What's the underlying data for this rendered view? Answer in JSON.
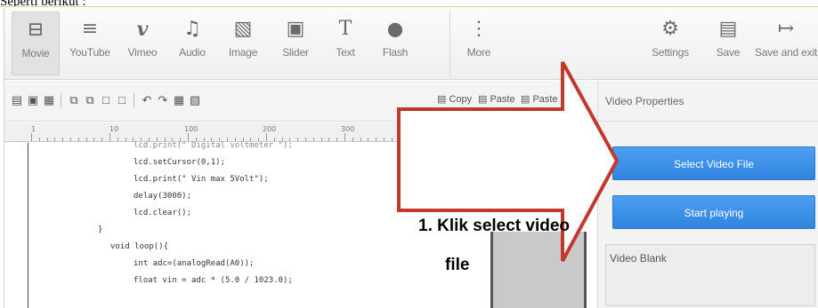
{
  "caption": "Seperti berikut :",
  "toolbar": {
    "items": [
      {
        "label": "Movie",
        "icon": "movie-icon",
        "glyph": "⊟"
      },
      {
        "label": "YouTube",
        "icon": "youtube-icon",
        "glyph": "≡"
      },
      {
        "label": "Vimeo",
        "icon": "vimeo-icon",
        "glyph": "v"
      },
      {
        "label": "Audio",
        "icon": "music-note-icon",
        "glyph": "♫"
      },
      {
        "label": "Image",
        "icon": "image-icon",
        "glyph": "▧"
      },
      {
        "label": "Slider",
        "icon": "slider-icon",
        "glyph": "▣"
      },
      {
        "label": "Text",
        "icon": "text-icon",
        "glyph": "T"
      },
      {
        "label": "Flash",
        "icon": "flash-icon",
        "glyph": "⬤"
      },
      {
        "label": "More",
        "icon": "more-icon",
        "glyph": "⋮"
      },
      {
        "label": "Settings",
        "icon": "gear-icon",
        "glyph": "⚙"
      },
      {
        "label": "Save",
        "icon": "save-icon",
        "glyph": "▤"
      },
      {
        "label": "Save and exit",
        "icon": "save-exit-icon",
        "glyph": "↦"
      }
    ]
  },
  "toolbar2": {
    "copy": "Copy",
    "paste": "Paste",
    "paste_special": "Paste"
  },
  "ruler": {
    "marks": [
      "1",
      "10",
      "100",
      "200",
      "300"
    ]
  },
  "code": {
    "lines": [
      "lcd.print(\" Digital voltmeter \");",
      "lcd.setCursor(0,1);",
      "lcd.print(\" Vin max 5Volt\");",
      "delay(3000);",
      "lcd.clear();",
      "}",
      "void loop(){",
      "int adc=(analogRead(A0));",
      "float vin = adc * (5.0 / 1023.0);"
    ]
  },
  "properties": {
    "title": "Video Properties",
    "select_button": "Select Video File",
    "play_button": "Start playing",
    "status": "Video Blank"
  },
  "annotation": {
    "line1": "1. Klik  select video",
    "line2": "file",
    "color": "#c0392b"
  }
}
